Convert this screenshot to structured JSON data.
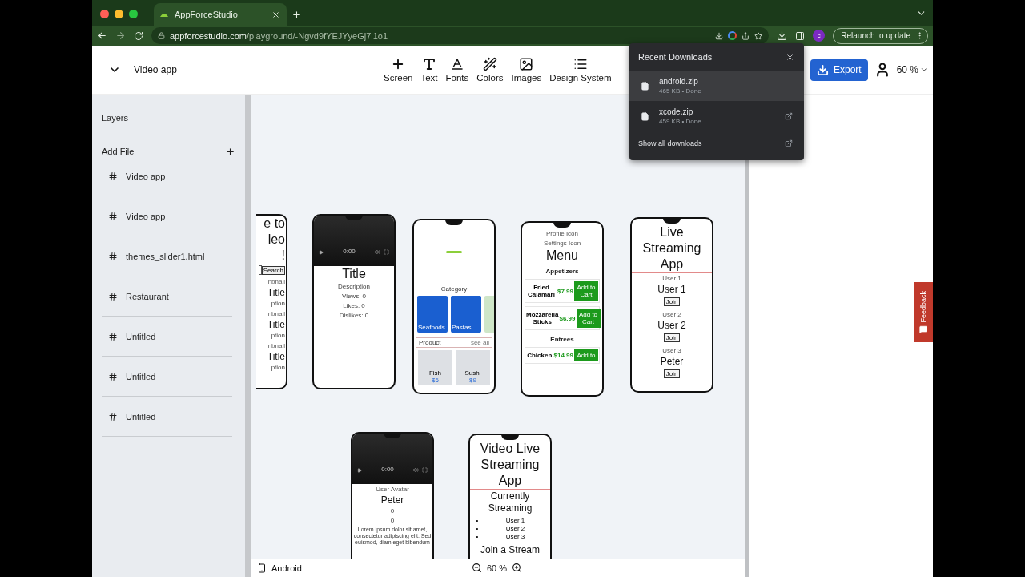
{
  "browser": {
    "tab_title": "AppForceStudio",
    "url_host": "appforcestudio.com",
    "url_path": "/playground/-Ngvd9fYEJYyeGj7i1o1",
    "profile": "c",
    "relaunch": "Relaunch to update"
  },
  "toolbar": {
    "project": "Video app",
    "tools": [
      {
        "kind": "screen",
        "label": "Screen"
      },
      {
        "kind": "text",
        "label": "Text"
      },
      {
        "kind": "fonts",
        "label": "Fonts"
      },
      {
        "kind": "colors",
        "label": "Colors"
      },
      {
        "kind": "images",
        "label": "Images"
      },
      {
        "kind": "design",
        "label": "Design System"
      }
    ],
    "export": "Export",
    "zoom": "60 %"
  },
  "sidebar": {
    "title": "Layers",
    "add_file": "Add File",
    "files": [
      {
        "name": "Video app"
      },
      {
        "name": "Video app"
      },
      {
        "name": "themes_slider1.html"
      },
      {
        "name": "Restaurant"
      },
      {
        "name": "Untitled"
      },
      {
        "name": "Untitled"
      },
      {
        "name": "Untitled"
      }
    ]
  },
  "phones": [
    {
      "items": [
        {
          "kind": "title",
          "text": "e to"
        },
        {
          "kind": "title",
          "text": "leo"
        },
        {
          "kind": "title",
          "text": "!"
        },
        {
          "kind": "search",
          "text": "Search"
        },
        {
          "kind": "alt",
          "text": "nbnail"
        },
        {
          "kind": "subtitle",
          "text": "Title"
        },
        {
          "kind": "small",
          "text": "ption"
        },
        {
          "kind": "alt",
          "text": "nbnail"
        },
        {
          "kind": "subtitle",
          "text": "Title"
        },
        {
          "kind": "small",
          "text": "ption"
        },
        {
          "kind": "alt",
          "text": "nbnail"
        },
        {
          "kind": "subtitle",
          "text": "Title"
        },
        {
          "kind": "small",
          "text": "ption"
        }
      ]
    },
    {
      "items": [
        {
          "kind": "video",
          "text": "0:00"
        },
        {
          "kind": "title",
          "text": "Title"
        },
        {
          "kind": "small",
          "text": "Description"
        },
        {
          "kind": "small",
          "text": "Views: 0"
        },
        {
          "kind": "small",
          "text": "Likes: 0"
        },
        {
          "kind": "small",
          "text": "Dislikes: 0"
        }
      ]
    },
    {
      "items": [
        {
          "kind": "logo"
        },
        {
          "kind": "label",
          "text": "Category"
        },
        {
          "kind": "tiles",
          "tiles": [
            {
              "text": "Seafoods",
              "color": "#1a5fd0"
            },
            {
              "text": "Pastas",
              "color": "#1a5fd0"
            },
            {
              "color": "#cfe6c8"
            }
          ]
        },
        {
          "kind": "bar",
          "text": "Product",
          "link": "see all"
        },
        {
          "kind": "cards",
          "cards": [
            {
              "name": "Fish",
              "price": "$6"
            },
            {
              "name": "Sushi",
              "price": "$9"
            }
          ]
        }
      ]
    },
    {
      "items": [
        {
          "kind": "alt",
          "text": "Profile Icon"
        },
        {
          "kind": "alt",
          "text": "Settings Icon"
        },
        {
          "kind": "title",
          "text": "Menu"
        },
        {
          "kind": "heading",
          "text": "Appetizers"
        },
        {
          "kind": "dish",
          "name": "Fried Calamari",
          "price": "$7.99",
          "button": "Add to Cart"
        },
        {
          "kind": "dish",
          "name": "Mozzarella Sticks",
          "price": "$6.99",
          "button": "Add to Cart"
        },
        {
          "kind": "heading",
          "text": "Entrees"
        },
        {
          "kind": "dish",
          "name": "Chicken",
          "price": "$14.99",
          "button": "Add to"
        }
      ]
    },
    {
      "items": [
        {
          "kind": "title",
          "text": "Live Streaming App"
        },
        {
          "kind": "rule"
        },
        {
          "kind": "alt",
          "text": "User 1"
        },
        {
          "kind": "subtitle",
          "text": "User 1"
        },
        {
          "kind": "button",
          "text": "Join"
        },
        {
          "kind": "rule"
        },
        {
          "kind": "alt",
          "text": "User 2"
        },
        {
          "kind": "subtitle",
          "text": "User 2"
        },
        {
          "kind": "button",
          "text": "Join"
        },
        {
          "kind": "rule"
        },
        {
          "kind": "alt",
          "text": "User 3"
        },
        {
          "kind": "subtitle",
          "text": "Peter"
        },
        {
          "kind": "button",
          "text": "Join"
        }
      ]
    },
    {
      "items": [
        {
          "kind": "video",
          "text": "0:00"
        },
        {
          "kind": "alt",
          "text": "User Avatar"
        },
        {
          "kind": "subtitle",
          "text": "Peter"
        },
        {
          "kind": "small",
          "text": "0"
        },
        {
          "kind": "small",
          "text": "0"
        },
        {
          "kind": "para",
          "text": "Lorem ipsum dolor sit amet, consectetur adipiscing elit. Sed euismod, diam eget bibendum"
        }
      ]
    },
    {
      "items": [
        {
          "kind": "title",
          "text": "Video Live Streaming App"
        },
        {
          "kind": "rule"
        },
        {
          "kind": "subtitle",
          "text": "Currently Streaming"
        },
        {
          "kind": "bullets",
          "list": [
            {
              "marker": "•",
              "text": "User 1"
            },
            {
              "marker": "•",
              "text": "User 2"
            },
            {
              "marker": "•",
              "text": "User 3"
            }
          ]
        },
        {
          "kind": "subtitle",
          "text": "Join a Stream"
        }
      ]
    }
  ],
  "bottom_bar": {
    "device": "Android",
    "zoom": "60 %"
  },
  "feedback": "Feedback",
  "downloads": {
    "title": "Recent Downloads",
    "items": [
      {
        "name": "android.zip",
        "meta": "465 KB • Done",
        "highlighted": true
      },
      {
        "name": "xcode.zip",
        "meta": "459 KB • Done",
        "highlighted": false
      }
    ],
    "show_all": "Show all downloads"
  }
}
